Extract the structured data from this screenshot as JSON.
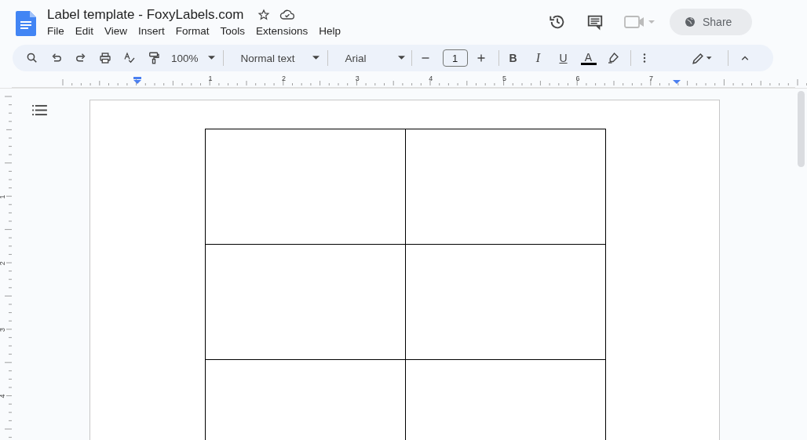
{
  "document": {
    "title": "Label template - FoxyLabels.com"
  },
  "menu": [
    "File",
    "Edit",
    "View",
    "Insert",
    "Format",
    "Tools",
    "Extensions",
    "Help"
  ],
  "share_button": {
    "label": "Share"
  },
  "toolbar": {
    "zoom": "100%",
    "style": "Normal text",
    "font": "Arial",
    "font_size": "1",
    "bold_label": "B",
    "italic_label": "I",
    "underline_label": "U",
    "text_color_label": "A"
  },
  "horizontal_ruler": [
    "1",
    "2",
    "3",
    "4",
    "5",
    "6",
    "7"
  ],
  "vertical_ruler": [
    "1",
    "2",
    "3",
    "4"
  ],
  "label_table": {
    "rows": [
      {
        "cells": [
          {
            "kind": "empty"
          },
          {
            "kind": "empty"
          }
        ]
      },
      {
        "cells": [
          {
            "kind": "empty"
          },
          {
            "kind": "empty"
          }
        ]
      },
      {
        "cells": [
          {
            "kind": "empty"
          },
          {
            "kind": "empty"
          }
        ]
      }
    ]
  }
}
